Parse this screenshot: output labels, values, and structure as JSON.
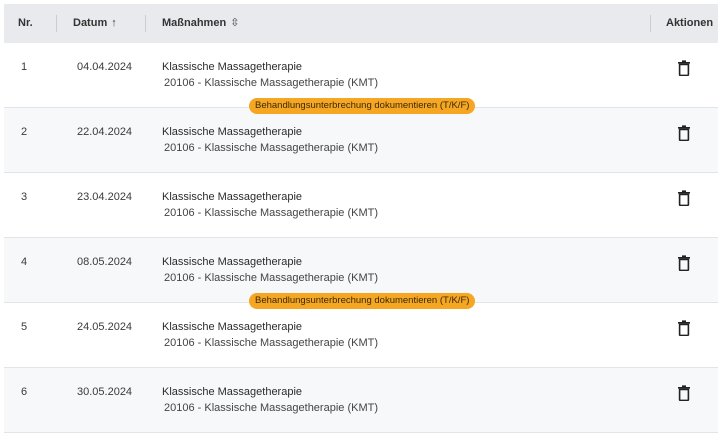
{
  "header": {
    "nr": "Nr.",
    "datum": "Datum",
    "datum_sort": "↑",
    "massnahmen": "Maßnahmen",
    "massnahmen_sort": "⇳",
    "aktionen": "Aktionen"
  },
  "rows": [
    {
      "nr": "1",
      "datum": "04.04.2024",
      "title": "Klassische Massagetherapie",
      "code": "20106 - Klassische Massagetherapie (KMT)"
    },
    {
      "nr": "2",
      "datum": "22.04.2024",
      "title": "Klassische Massagetherapie",
      "code": "20106 - Klassische Massagetherapie (KMT)",
      "badge": "Behandlungsunterbrechung dokumentieren (T/K/F)"
    },
    {
      "nr": "3",
      "datum": "23.04.2024",
      "title": "Klassische Massagetherapie",
      "code": "20106 - Klassische Massagetherapie (KMT)"
    },
    {
      "nr": "4",
      "datum": "08.05.2024",
      "title": "Klassische Massagetherapie",
      "code": "20106 - Klassische Massagetherapie (KMT)"
    },
    {
      "nr": "5",
      "datum": "24.05.2024",
      "title": "Klassische Massagetherapie",
      "code": "20106 - Klassische Massagetherapie (KMT)",
      "badge": "Behandlungsunterbrechung dokumentieren (T/K/F)"
    },
    {
      "nr": "6",
      "datum": "30.05.2024",
      "title": "Klassische Massagetherapie",
      "code": "20106 - Klassische Massagetherapie (KMT)"
    }
  ],
  "icons": {
    "delete": "trash-icon",
    "sort_asc": "arrow-up-icon",
    "sort_both": "sort-icon"
  },
  "colors": {
    "header_bg": "#e8eaed",
    "badge_bg": "#f5a623",
    "row_alt_bg": "#f7f8f9"
  }
}
